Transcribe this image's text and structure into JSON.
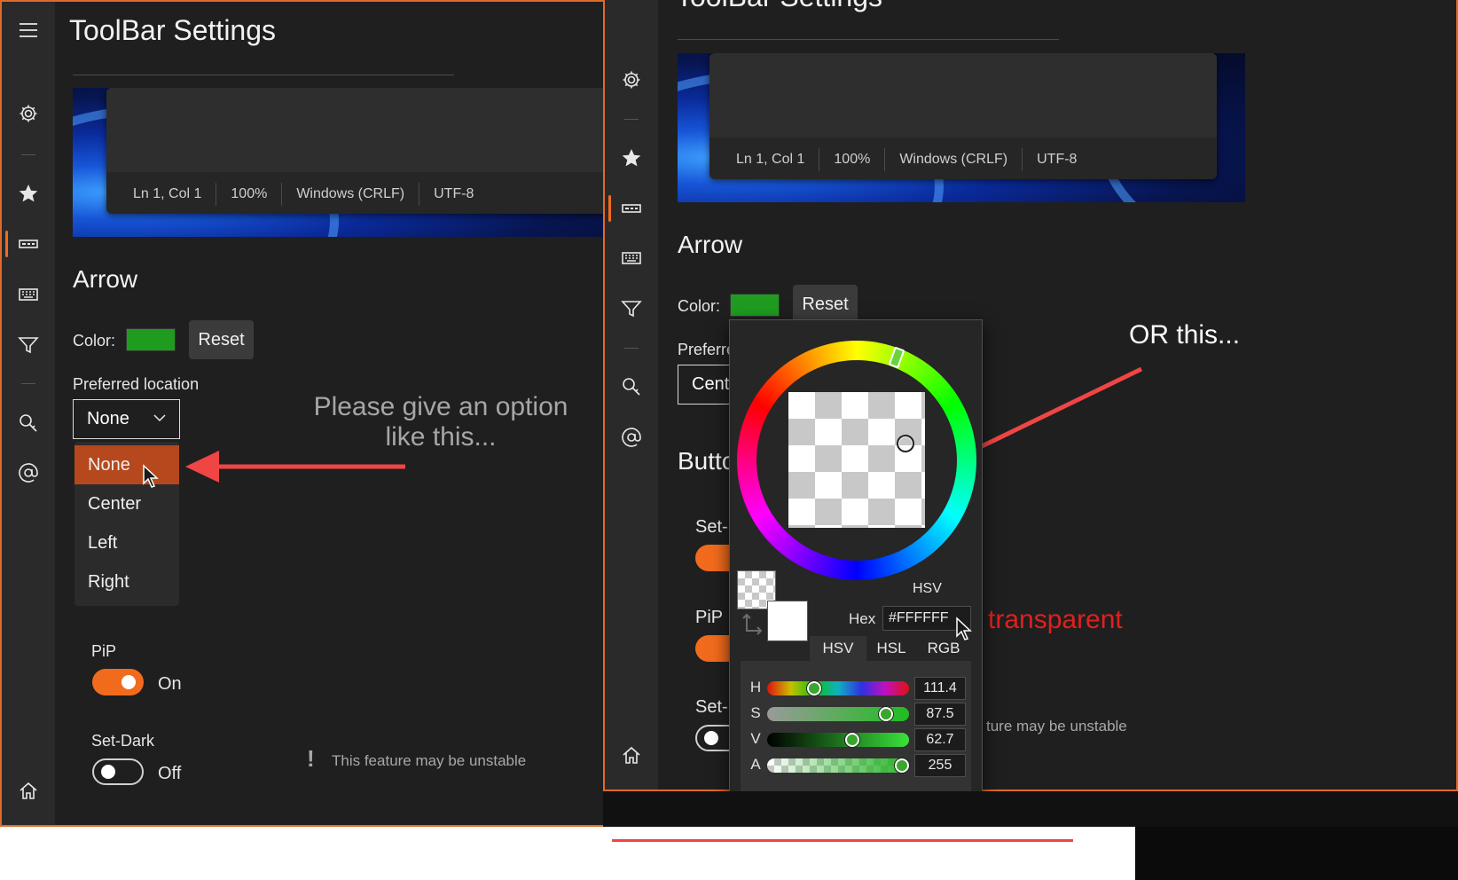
{
  "left": {
    "title": "ToolBar Settings",
    "status_items": [
      "Ln 1, Col 1",
      "100%",
      "Windows (CRLF)",
      "UTF-8"
    ],
    "section": "Arrow",
    "color_label": "Color:",
    "color_value": "#1f9c1f",
    "reset_label": "Reset",
    "pref_label": "Preferred location",
    "combo_value": "None",
    "options": [
      "None",
      "Center",
      "Left",
      "Right"
    ],
    "pip_label": "PiP",
    "pip_state": "On",
    "setdark_label": "Set-Dark",
    "setdark_state": "Off",
    "warning": "This feature may be unstable",
    "warning_mark": "!",
    "annotation_line1": "Please give an option",
    "annotation_line2": "like this..."
  },
  "right": {
    "title": "ToolBar Settings",
    "status_items": [
      "Ln 1, Col 1",
      "100%",
      "Windows (CRLF)",
      "UTF-8"
    ],
    "section": "Arrow",
    "color_label": "Color:",
    "reset_label": "Reset",
    "pref_clipped": "Preferre",
    "combo_clipped": "Cent",
    "section2_clipped": "Butto",
    "row1_clipped": "Set-",
    "pip_label": "PiP",
    "row3_clipped": "Set-",
    "warning_clipped": "ture may be unstable",
    "annotation": "OR this...",
    "transparent_note": "transparent"
  },
  "picker": {
    "mode_label": "HSV",
    "hex_label": "Hex",
    "hex_value": "#FFFFFF",
    "tabs": [
      "HSV",
      "HSL",
      "RGB"
    ],
    "active_tab": "HSV",
    "channels": [
      {
        "label": "H",
        "value": "111.4",
        "fraction": 0.33
      },
      {
        "label": "S",
        "value": "87.5",
        "fraction": 0.84
      },
      {
        "label": "V",
        "value": "62.7",
        "fraction": 0.6
      },
      {
        "label": "A",
        "value": "255",
        "fraction": 0.95
      }
    ]
  },
  "colors": {
    "accent": "#f26b1d",
    "selected_item": "#b5481d",
    "annotation_arrow": "#f04545",
    "transparent_text": "#e02020"
  }
}
